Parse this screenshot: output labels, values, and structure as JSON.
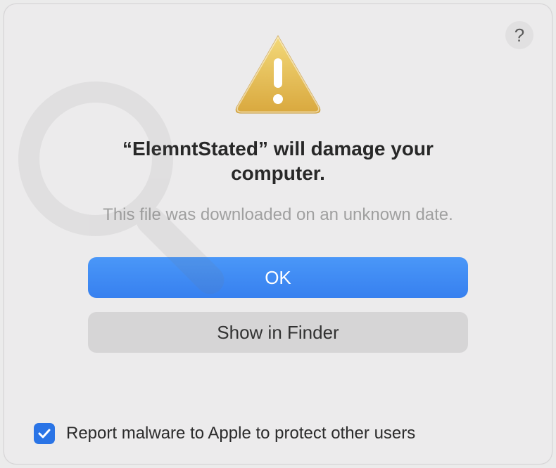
{
  "dialog": {
    "help_label": "?",
    "headline_prefix": "“",
    "app_name": "ElemntStated",
    "headline_suffix": "” will damage your computer.",
    "subtext": "This file was downloaded on an unknown date.",
    "primary_button": "OK",
    "secondary_button": "Show in Finder",
    "checkbox_checked": true,
    "checkbox_label": "Report malware to Apple to protect other users"
  },
  "icon": {
    "name": "warning-triangle"
  },
  "colors": {
    "primary": "#3c85f1",
    "secondary": "#d6d5d6",
    "checkbox": "#2a74e6"
  }
}
